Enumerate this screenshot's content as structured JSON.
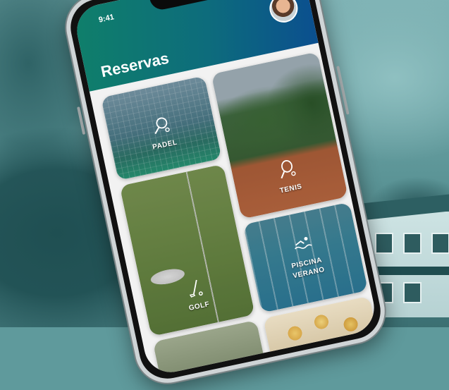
{
  "status_bar": {
    "time": "9:41"
  },
  "header": {
    "title": "Reservas"
  },
  "cards": {
    "padel": {
      "label": "PADEL",
      "icon": "padel-racket-icon"
    },
    "tenis": {
      "label": "TENIS",
      "icon": "tennis-racket-icon"
    },
    "golf": {
      "label": "GOLF",
      "icon": "golf-club-icon"
    },
    "piscina": {
      "label_line1": "PISCINA",
      "label_line2": "VERANO",
      "icon": "swimmer-icon"
    }
  },
  "colors": {
    "header_start": "#0f7f6a",
    "header_end": "#0b4f8f",
    "background_tint": "#5f9a9c"
  }
}
